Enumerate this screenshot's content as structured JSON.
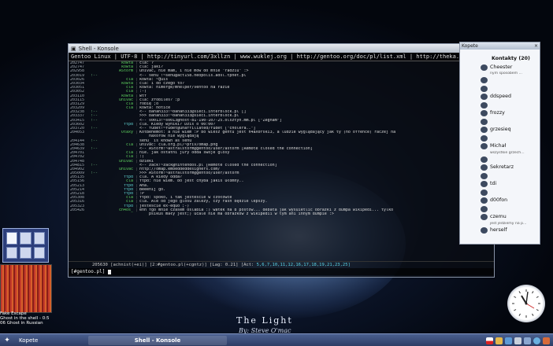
{
  "desktop": {
    "wallpaper_title": "The Light",
    "wallpaper_sign": "By: Steve O'mac"
  },
  "konsole": {
    "title": "Shell - Konsole",
    "topic": "Gentoo Linux | UTF-8 | http://tinyurl.com/3xllzn | www.wuklej.org | http://gentoo.org/doc/pl/list.xml | http://theka.tk/plitery | Za pyta",
    "lines": [
      {
        "t": "202747",
        "m": "",
        "n": "kowta",
        "nc": "c-green",
        "x": "cla: ?"
      },
      {
        "t": "202747",
        "m": "",
        "n": "kowta",
        "nc": "c-green",
        "x": "cla: jaki?"
      },
      {
        "t": "202958",
        "m": "",
        "n": "AStorm",
        "nc": "c-green",
        "x": "univac, nie mam, i nie mów do mnie \"radziu\" :>"
      },
      {
        "t": "203019",
        "m": "!--",
        "n": "",
        "nc": "c-grey",
        "x": "<-- senu_!~senu@act158.neopolis.adsl.tpnet.pl"
      },
      {
        "t": "203026",
        "m": "",
        "n": "cla",
        "nc": "c-green",
        "x": "kowta: ~guis"
      },
      {
        "t": "203034",
        "m": "",
        "n": "kowta",
        "nc": "c-green",
        "x": "cla: i do czego to?"
      },
      {
        "t": "203051",
        "m": "",
        "n": "cla",
        "nc": "c-green",
        "x": "kowta: himerge/mhelper/ventoo na razie"
      },
      {
        "t": "203052",
        "m": "",
        "n": "cla",
        "nc": "c-green",
        "x": ":-)"
      },
      {
        "t": "203110",
        "m": "",
        "n": "kowta",
        "nc": "c-green",
        "x": "wtf"
      },
      {
        "t": "203115",
        "m": "",
        "n": "univac",
        "nc": "c-green",
        "x": "cla: zrobiles? :p"
      },
      {
        "t": "203129",
        "m": "",
        "n": "cla",
        "nc": "c-green",
        "x": "robię ;o"
      },
      {
        "t": "203209",
        "m": "",
        "n": "cla",
        "nc": "c-green",
        "x": "kowta: notice"
      },
      {
        "t": "203238",
        "m": "!--",
        "n": "",
        "nc": "c-grey",
        "x": "<-- banan333!~banan333@sieci.interblock.pl []"
      },
      {
        "t": "203337",
        "m": "!--",
        "n": "",
        "nc": "c-grey",
        "x": ">>> banan333!~banan333@sieci.interblock.pl"
      },
      {
        "t": "203415",
        "m": "!--",
        "n": "",
        "nc": "c-grey",
        "x": "<-- s0013!~s0013@host-81-190-107-25.olsztyn.mm.pl [\"Żegnam\"]"
      },
      {
        "t": "203602",
        "m": "",
        "n": "ftpd",
        "nc": "c-cyan",
        "x": "cla. Kiedy wyniki? Dziś o 00:00?"
      },
      {
        "t": "203720",
        "m": "!--",
        "n": "",
        "nc": "c-grey",
        "x": "<-- fudet!~fudet@unaffiliated/fudet [\"cholera..\"]"
      },
      {
        "t": "204053",
        "m": "",
        "n": "Otaxy",
        "nc": "c-green",
        "x": "KotBehemot: a nie wiem :P bo wiesz gentu jest h4aX0rski3, a ludzie wyglądający jak ty (no offence) raczej na"
      },
      {
        "t": "",
        "m": "",
        "n": "",
        "nc": "c-grey",
        "x": "    haxorów nie wyglądają"
      },
      {
        "t": "204144",
        "m": "!--",
        "n": "",
        "nc": "c-grey",
        "x": "senu_ is known as senu"
      },
      {
        "t": "204638",
        "m": "",
        "n": "cla",
        "nc": "c-green",
        "x": "univac: cla.org.pl/~priv/omap.png"
      },
      {
        "t": "204639",
        "m": "!--",
        "n": "",
        "nc": "c-grey",
        "x": "<-- AStorm!~astralstorm@gentoo/user/astorm [Remote closed the connection]"
      },
      {
        "t": "204701",
        "m": "",
        "n": "cla",
        "nc": "c-green",
        "x": "nie. jak ostatni jury odda swoje glosy"
      },
      {
        "t": "204702",
        "m": "",
        "n": "cla",
        "nc": "c-green",
        "x": ":)"
      },
      {
        "t": "204748",
        "m": "",
        "n": "univac",
        "nc": "c-green",
        "x": "dzieki"
      },
      {
        "t": "204815",
        "m": "!--",
        "n": "",
        "nc": "c-grey",
        "x": "<-- zack!~zack@nintendos.pl [Remote closed the connection]"
      },
      {
        "t": "204902",
        "m": "",
        "n": "univac",
        "nc": "c-green",
        "x": "http://omap.embeddeddesigners.com/"
      },
      {
        "t": "205009",
        "m": "!--",
        "n": "",
        "nc": "c-grey",
        "x": ">>> AStorm!~astralstorm@gentoo/user/astorm"
      },
      {
        "t": "205135",
        "m": "",
        "n": "ftpd",
        "nc": "c-cyan",
        "x": "cla. A kiedy odda?"
      },
      {
        "t": "205156",
        "m": "",
        "n": "cla",
        "nc": "c-green",
        "x": "ftpd: nie wiem. bo jest chyba jakiś ułomny.."
      },
      {
        "t": "205213",
        "m": "",
        "n": "ftpd",
        "nc": "c-cyan",
        "x": "Aha."
      },
      {
        "t": "205214",
        "m": "",
        "n": "ftpd",
        "nc": "c-cyan",
        "x": "Beeenij go."
      },
      {
        "t": "205218",
        "m": "",
        "n": "ftpd",
        "nc": "c-cyan",
        "x": ":P"
      },
      {
        "t": "205308",
        "m": "",
        "n": "cla",
        "nc": "c-green",
        "x": "ftpd: spoko, i tak jesteście w czołówce"
      },
      {
        "t": "205316",
        "m": "",
        "n": "cla",
        "nc": "c-green",
        "x": "cla. Ale od jego glosu zależy, czy rash będzie lepszy."
      },
      {
        "t": "205323",
        "m": "",
        "n": "ftpd",
        "nc": "c-cyan",
        "x": "jesteście ex-equo ;-)"
      },
      {
        "t": "205426",
        "m": "",
        "n": "ch4os_",
        "nc": "c-green",
        "x": "ehh fgo mnie czasem oslabia :) watek na 8 postow... debata jak wysuietlic obrazki z dumpa wikipedi... tylko"
      },
      {
        "t": "",
        "m": "",
        "n": "",
        "nc": "c-grey",
        "x": "    psikus mały jest;) ucale nie ma obrazków z wikipedii w tym ani innym dumpie :>"
      }
    ],
    "status": {
      "time": "205630",
      "nick": "[achnist(+ei)]",
      "channel": "[2:#gentoo.pl(+cgntz)]",
      "lag": "[Lag: 0.21]",
      "act_label": "[Act: ",
      "act_values": "5,6,7,10,11,12,16,17,18,19,21,23,25]"
    },
    "input": {
      "prompt": "[#gentoo.pl]"
    }
  },
  "kopete": {
    "title": "Kopete",
    "items": [
      {
        "text": "Kontakty (20)",
        "sub": false,
        "hdr": true
      },
      {
        "text": "Cheester",
        "sub": false
      },
      {
        "text": "nym sposobem ...",
        "sub": true
      },
      {
        "text": "",
        "sub": false
      },
      {
        "text": "",
        "sub": false
      },
      {
        "text": "ddspeed",
        "sub": false
      },
      {
        "text": "",
        "sub": false
      },
      {
        "text": "frozzy",
        "sub": false
      },
      {
        "text": "",
        "sub": false
      },
      {
        "text": "grzesieq",
        "sub": false
      },
      {
        "text": "",
        "sub": false
      },
      {
        "text": "Michał",
        "sub": false
      },
      {
        "text": "wszystkie grzech...",
        "sub": true
      },
      {
        "text": "",
        "sub": false
      },
      {
        "text": "Sekretarz",
        "sub": false
      },
      {
        "text": "",
        "sub": false
      },
      {
        "text": "tdi",
        "sub": false
      },
      {
        "text": "",
        "sub": false
      },
      {
        "text": "d00fon",
        "sub": false
      },
      {
        "text": "",
        "sub": false
      },
      {
        "text": "czemu",
        "sub": false
      },
      {
        "text": "jest jedziemy na p...",
        "sub": true
      },
      {
        "text": "herself",
        "sub": false
      }
    ]
  },
  "media": {
    "line1": "Fake Escape",
    "line2": "Ghost in the shell - 0:5",
    "line3": "06 Ghost in Russian"
  },
  "taskbar": {
    "kopete": "Kopete",
    "konsole": "Shell - Konsole"
  },
  "colors": {
    "taskbar": "#2b3a62",
    "nick": "#5fd35f",
    "act": "#5cd5e6"
  }
}
